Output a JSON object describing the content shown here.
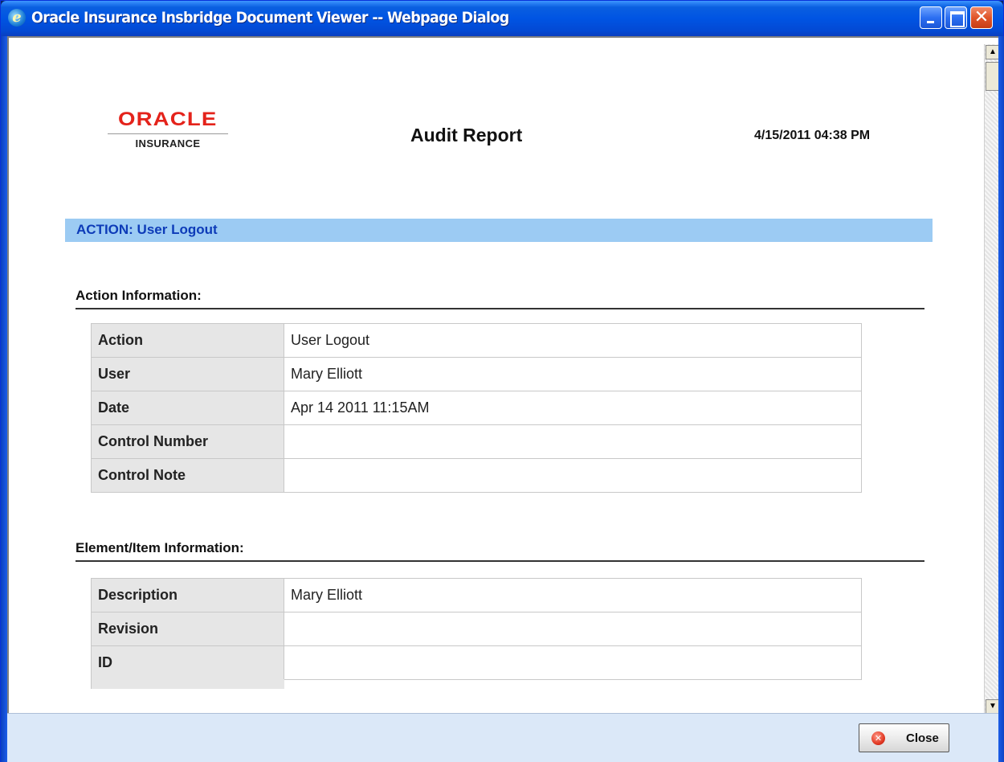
{
  "window": {
    "title": "Oracle Insurance Insbridge Document Viewer -- Webpage Dialog",
    "icon": "ie-icon",
    "controls": {
      "minimize": "minimize-icon",
      "maximize": "maximize-icon",
      "close": "✕"
    }
  },
  "report": {
    "logo": {
      "brand": "ORACLE",
      "sub": "INSURANCE"
    },
    "title": "Audit Report",
    "timestamp": "4/15/2011 04:38 PM",
    "action_banner": "ACTION:  User Logout"
  },
  "sections": {
    "action_info": {
      "title": "Action Information:",
      "rows": [
        {
          "label": "Action",
          "value": "User Logout"
        },
        {
          "label": "User",
          "value": "Mary Elliott"
        },
        {
          "label": "Date",
          "value": "Apr 14 2011 11:15AM"
        },
        {
          "label": "Control Number",
          "value": ""
        },
        {
          "label": "Control Note",
          "value": ""
        }
      ]
    },
    "element_info": {
      "title": "Element/Item Information:",
      "rows": [
        {
          "label": "Description",
          "value": "Mary Elliott"
        },
        {
          "label": "Revision",
          "value": ""
        },
        {
          "label": "ID",
          "value": ""
        }
      ]
    }
  },
  "scrollbar": {
    "up": "▲",
    "down": "▼"
  },
  "footer": {
    "close_label": "Close",
    "close_icon": "✕"
  },
  "colors": {
    "banner_bg": "#9ccbf3",
    "banner_text": "#0d3bb8",
    "logo_red": "#e4231b",
    "titlebar": "#0054e3"
  }
}
